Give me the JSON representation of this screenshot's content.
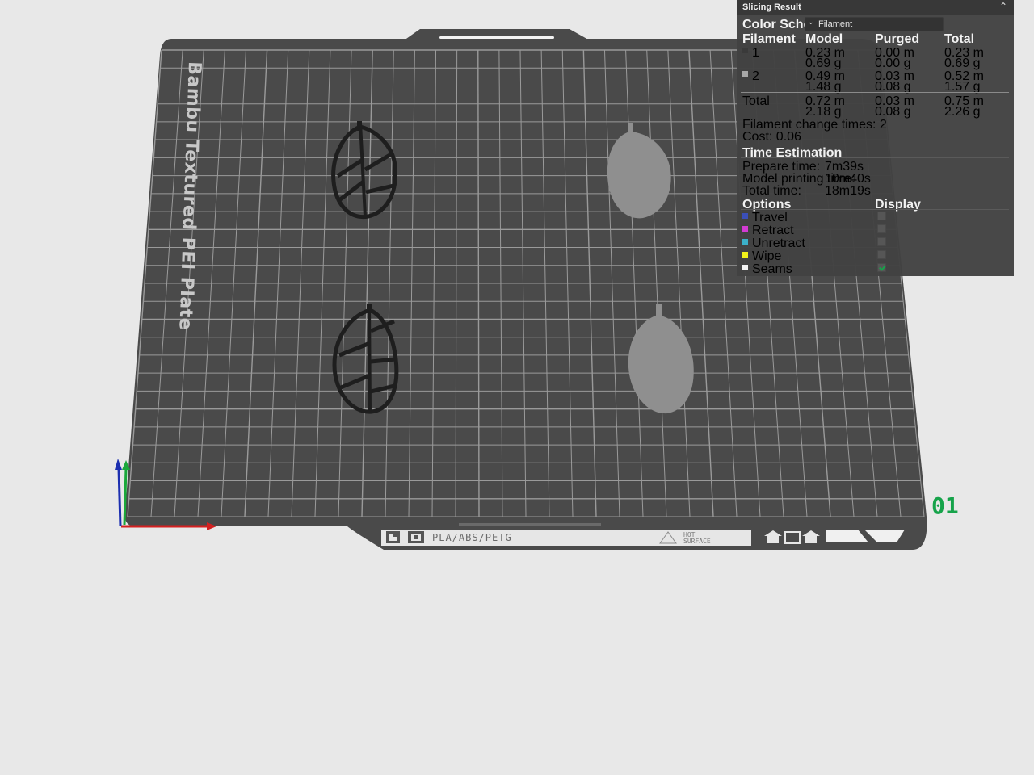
{
  "plate": {
    "name_text": "Bambu Textured PEI Plate",
    "material_text": "PLA/ABS/PETG",
    "hot_line1": "HOT",
    "hot_line2": "SURFACE",
    "plate_number": "01"
  },
  "panel": {
    "title": "Slicing Result",
    "color_scheme_label": "Color Scheme",
    "color_scheme_value": "Filament",
    "columns": [
      "Filament",
      "Model",
      "Purged",
      "Total"
    ],
    "rows": [
      {
        "id": "1",
        "color": "#3a3a3a",
        "model_m": "0.23 m",
        "model_g": "0.69 g",
        "purged_m": "0.00 m",
        "purged_g": "0.00 g",
        "total_m": "0.23 m",
        "total_g": "0.69 g"
      },
      {
        "id": "2",
        "color": "#a8a8a8",
        "model_m": "0.49 m",
        "model_g": "1.48 g",
        "purged_m": "0.03 m",
        "purged_g": "0.08 g",
        "total_m": "0.52 m",
        "total_g": "1.57 g"
      }
    ],
    "total": {
      "label": "Total",
      "model_m": "0.72 m",
      "model_g": "2.18 g",
      "purged_m": "0.03 m",
      "purged_g": "0.08 g",
      "total_m": "0.75 m",
      "total_g": "2.26 g"
    },
    "filament_change": "Filament change times:  2",
    "cost": "Cost:  0.06",
    "time_heading": "Time Estimation",
    "prepare_label": "Prepare time:",
    "prepare_value": "7m39s",
    "model_time_label": "Model printing time:",
    "model_time_value": "10m40s",
    "total_time_label": "Total time:",
    "total_time_value": "18m19s",
    "options_heading": "Options",
    "display_heading": "Display",
    "options": [
      {
        "label": "Travel",
        "color": "#3b4fb8",
        "checked": false
      },
      {
        "label": "Retract",
        "color": "#d33bd3",
        "checked": false
      },
      {
        "label": "Unretract",
        "color": "#3bb0c8",
        "checked": false
      },
      {
        "label": "Wipe",
        "color": "#f2f21a",
        "checked": false
      },
      {
        "label": "Seams",
        "color": "#f2f2f2",
        "checked": true
      }
    ]
  },
  "colors": {
    "background": "#e8e8e8",
    "plate": "#4a4a4a",
    "grid": "#a9a9a9",
    "plate_number": "#16a34a",
    "axis_x": "#d42020",
    "axis_y": "#1aa83a",
    "axis_z": "#1c2fb0"
  }
}
